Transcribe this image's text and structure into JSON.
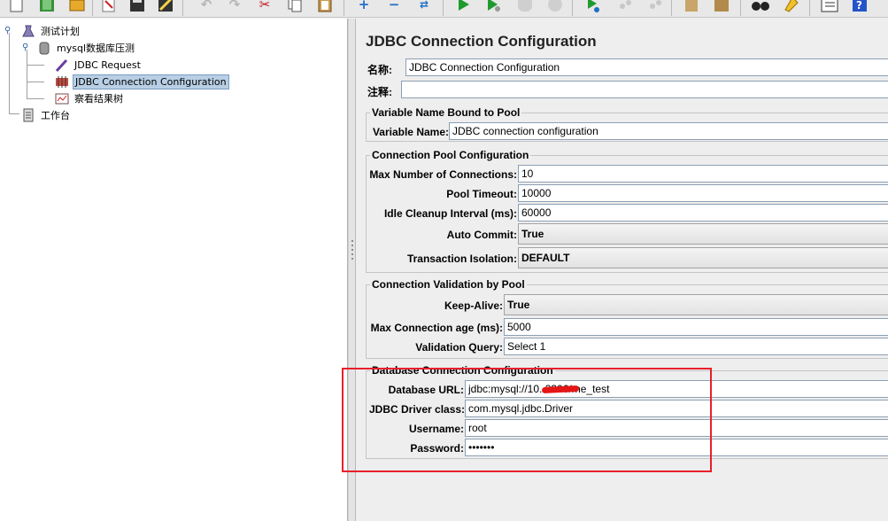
{
  "toolbar": {
    "icons": [
      "new-icon",
      "templates-icon",
      "open-icon",
      "close-icon",
      "save-icon",
      "save-as-icon",
      "cut-history-icon",
      "undo-icon",
      "redo-icon",
      "cut-icon",
      "copy-icon",
      "paste-icon",
      "expand-icon",
      "collapse-icon",
      "toggle-icon",
      "start-icon",
      "start-no-pause-icon",
      "stop-icon",
      "shutdown-icon",
      "remote-start-icon",
      "remote-stop-icon",
      "remote-shutdown-icon",
      "clear-icon",
      "clear-all-icon",
      "search-icon",
      "reset-search-icon",
      "function-helper-icon",
      "help-icon"
    ]
  },
  "tree": {
    "items": [
      {
        "label": "测试计划",
        "icon": "test-plan-icon"
      },
      {
        "label": "mysql数据库压测",
        "icon": "thread-group-icon"
      },
      {
        "label": "JDBC Request",
        "icon": "jdbc-request-icon"
      },
      {
        "label": "JDBC Connection Configuration",
        "icon": "config-element-icon",
        "selected": true
      },
      {
        "label": "察看结果树",
        "icon": "listener-icon"
      },
      {
        "label": "工作台",
        "icon": "workbench-icon"
      }
    ]
  },
  "config": {
    "title": "JDBC Connection Configuration",
    "name_label": "名称:",
    "name_value": "JDBC Connection Configuration",
    "comment_label": "注释:",
    "comment_value": "",
    "groups": {
      "variable": {
        "title": "Variable Name Bound to Pool",
        "var_label": "Variable Name:",
        "var_value": "JDBC connection configuration"
      },
      "pool": {
        "title": "Connection Pool Configuration",
        "max_conn_label": "Max Number of Connections:",
        "max_conn_value": "10",
        "timeout_label": "Pool Timeout:",
        "timeout_value": "10000",
        "idle_label": "Idle Cleanup Interval (ms):",
        "idle_value": "60000",
        "autocommit_label": "Auto Commit:",
        "autocommit_value": "True",
        "isolation_label": "Transaction Isolation:",
        "isolation_value": "DEFAULT"
      },
      "validation": {
        "title": "Connection Validation by Pool",
        "keepalive_label": "Keep-Alive:",
        "keepalive_value": "True",
        "age_label": "Max Connection age (ms):",
        "age_value": "5000",
        "query_label": "Validation Query:",
        "query_value": "Select 1"
      },
      "database": {
        "title": "Database Connection Configuration",
        "url_label": "Database URL:",
        "url_value": "jdbc:mysql://10.          3306/me_test",
        "driver_label": "JDBC Driver class:",
        "driver_value": "com.mysql.jdbc.Driver",
        "user_label": "Username:",
        "user_value": "root",
        "pass_label": "Password:",
        "pass_value": "•••••••"
      }
    }
  },
  "colors": {
    "highlight": "#e8202a",
    "selection": "#b8cfe5"
  }
}
